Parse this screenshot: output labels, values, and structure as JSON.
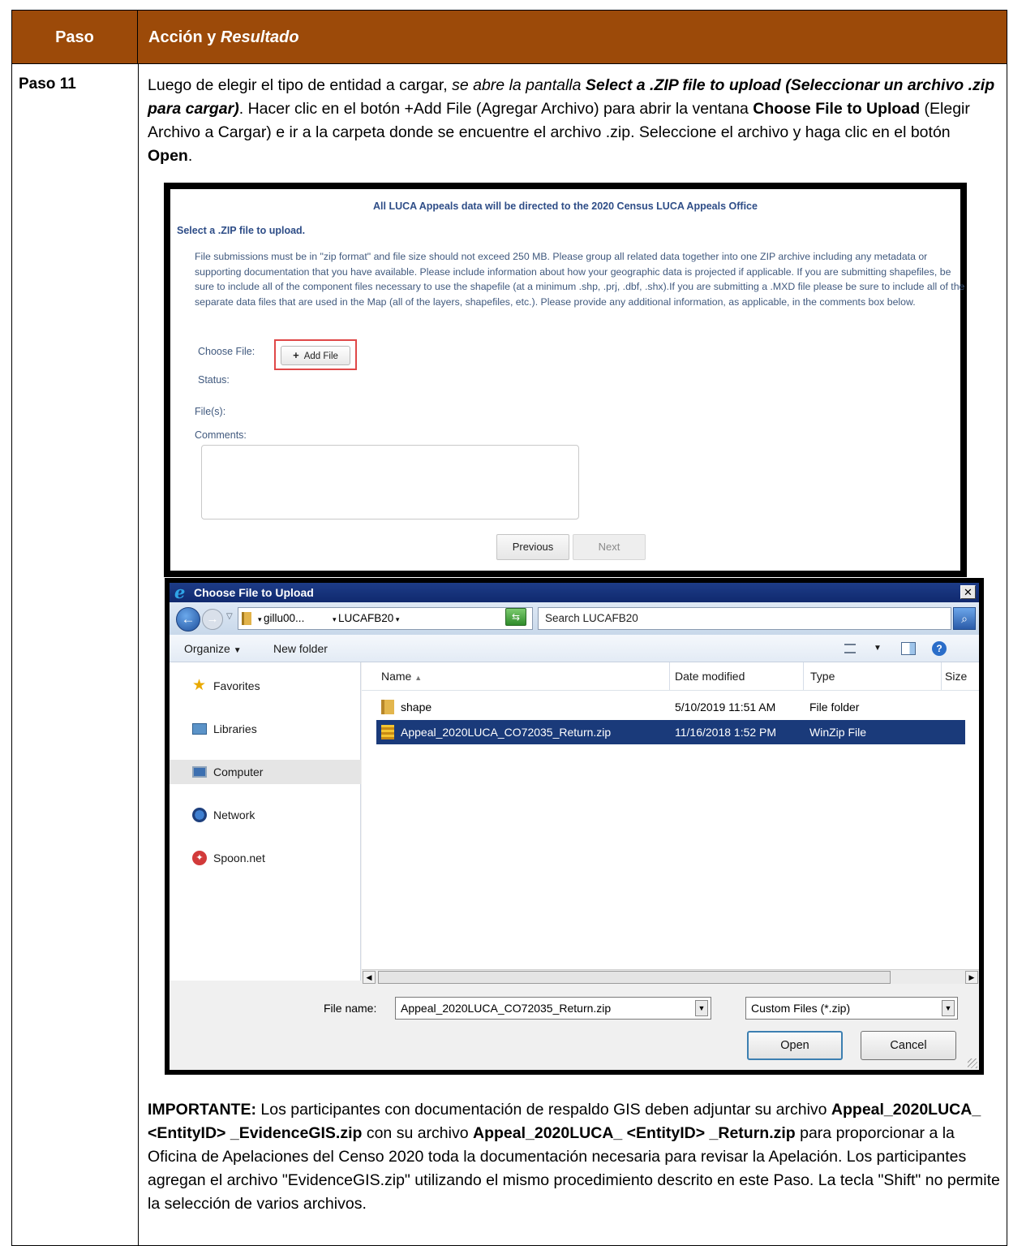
{
  "header": {
    "step_col": "Paso",
    "action_col_plain": "Acción y ",
    "action_col_italic": "Resultado"
  },
  "step": {
    "label": "Paso 11",
    "intro": {
      "p1": "Luego de elegir el tipo de entidad a cargar, ",
      "p2": "se abre la pantalla ",
      "p3": "Select a .ZIP file to upload (Seleccionar un archivo .zip para cargar)",
      "p4": ". Hacer clic en el botón +Add File (Agregar Archivo) para abrir la ventana ",
      "p5": "Choose File to Upload",
      "p6": " (Elegir Archivo a Cargar) e ir a la carpeta donde se encuentre el archivo .zip. Seleccione el archivo y haga clic en el botón ",
      "p7": "Open",
      "p8": "."
    },
    "important": {
      "label": "IMPORTANTE:",
      "t1": " Los participantes con documentación de respaldo GIS deben adjuntar su archivo ",
      "f1": "Appeal_2020LUCA_ <EntityID> _EvidenceGIS.zip",
      "t2": " con su archivo ",
      "f2": "Appeal_2020LUCA_ <EntityID> _Return.zip",
      "t3": " para proporcionar a la Oficina de Apelaciones del Censo 2020 toda la documentación necesaria para revisar la Apelación. Los participantes agregan el archivo \"EvidenceGIS.zip\" utilizando el mismo procedimiento descrito en este Paso. La tecla \"Shift\" no permite la selección de varios archivos."
    }
  },
  "upload_page": {
    "banner": "All LUCA Appeals data will be directed to the 2020 Census LUCA Appeals Office",
    "title": "Select a .ZIP file to upload.",
    "instructions": "File submissions must be in \"zip format\" and file size should not exceed 250 MB. Please group all related data together into one ZIP archive including any metadata or supporting documentation that you have available. Please include information about how your geographic data is projected if applicable. If you are submitting shapefiles, be sure to include all of the component files necessary to use the shapefile (at a minimum .shp, .prj, .dbf, .shx).If you are submitting a .MXD file please be sure to include all of the separate data files that are used in the Map (all of the layers, shapefiles, etc.). Please provide any additional information, as applicable, in the comments box below.",
    "choose_file_label": "Choose File:",
    "add_file_button": "Add File",
    "status_label": "Status:",
    "files_label": "File(s):",
    "comments_label": "Comments:",
    "previous_button": "Previous",
    "next_button": "Next"
  },
  "dialog": {
    "title": "Choose File to Upload",
    "close": "✕",
    "crumb_1": "gillu00...",
    "crumb_2": "LUCAFB20",
    "search_placeholder": "Search LUCAFB20",
    "organize": "Organize",
    "new_folder": "New folder",
    "nav": [
      "Favorites",
      "Libraries",
      "Computer",
      "Network",
      "Spoon.net"
    ],
    "columns": [
      "Name",
      "Date modified",
      "Type",
      "Size"
    ],
    "files": [
      {
        "name": "shape",
        "date": "5/10/2019 11:51 AM",
        "type": "File folder"
      },
      {
        "name": "Appeal_2020LUCA_CO72035_Return.zip",
        "date": "11/16/2018 1:52 PM",
        "type": "WinZip File"
      }
    ],
    "file_name_label": "File name:",
    "file_name_value": "Appeal_2020LUCA_CO72035_Return.zip",
    "filter_value": "Custom Files (*.zip)",
    "open_button": "Open",
    "cancel_button": "Cancel"
  }
}
